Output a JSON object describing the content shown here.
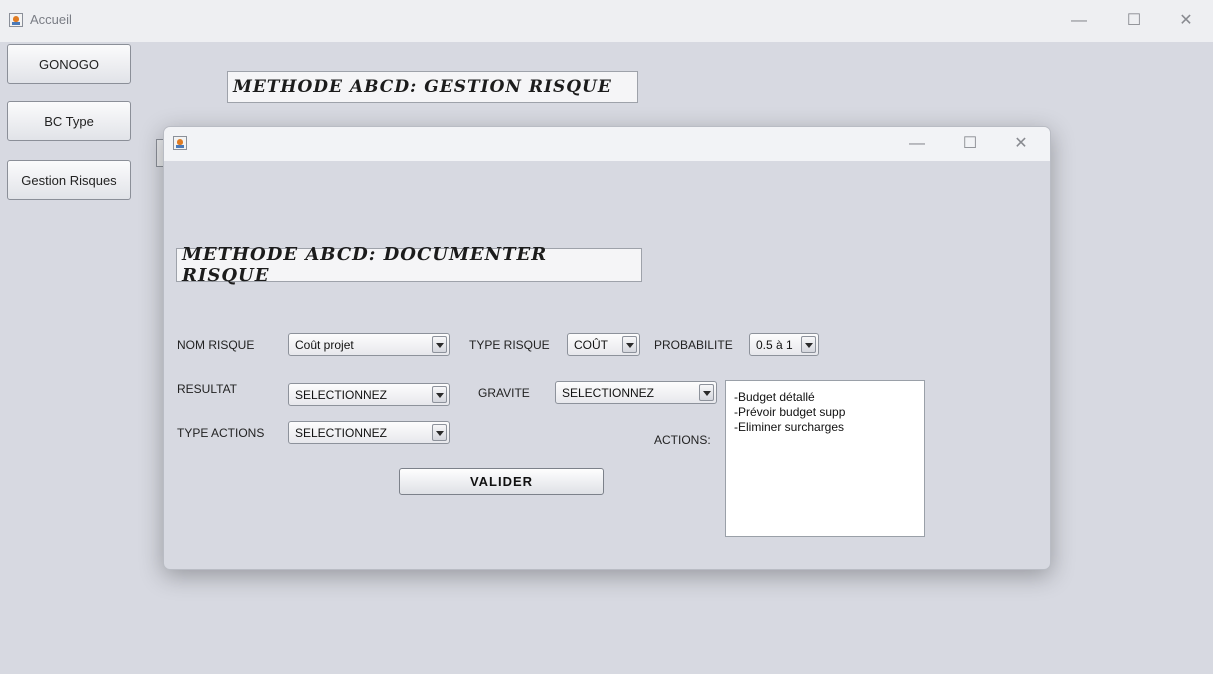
{
  "outer_window": {
    "title": "Accueil",
    "controls": {
      "minimize": "—",
      "maximize": "☐",
      "close": "✕"
    }
  },
  "sidebar": {
    "buttons": [
      {
        "label": "GONOGO"
      },
      {
        "label": "BC Type"
      },
      {
        "label": "Gestion Risques"
      }
    ]
  },
  "main": {
    "heading": "METHODE ABCD: GESTION RISQUE"
  },
  "dialog": {
    "title": "",
    "controls": {
      "minimize": "—",
      "maximize": "☐",
      "close": "✕"
    },
    "heading": "METHODE ABCD: DOCUMENTER RISQUE",
    "form": {
      "nom_risque": {
        "label": "NOM RISQUE",
        "value": "Coût projet"
      },
      "type_risque": {
        "label": "TYPE RISQUE",
        "value": "COÛT"
      },
      "probabilite": {
        "label": "PROBABILITE",
        "value": "0.5 à 1"
      },
      "resultat": {
        "label": "RESULTAT",
        "value": "SELECTIONNEZ"
      },
      "gravite": {
        "label": "GRAVITE",
        "value": "SELECTIONNEZ"
      },
      "type_actions": {
        "label": "TYPE ACTIONS",
        "value": "SELECTIONNEZ"
      },
      "actions": {
        "label": "ACTIONS:",
        "lines": [
          "-Budget détallé",
          "-Prévoir budget supp",
          "-Eliminer surcharges"
        ]
      },
      "submit_label": "VALIDER"
    }
  }
}
